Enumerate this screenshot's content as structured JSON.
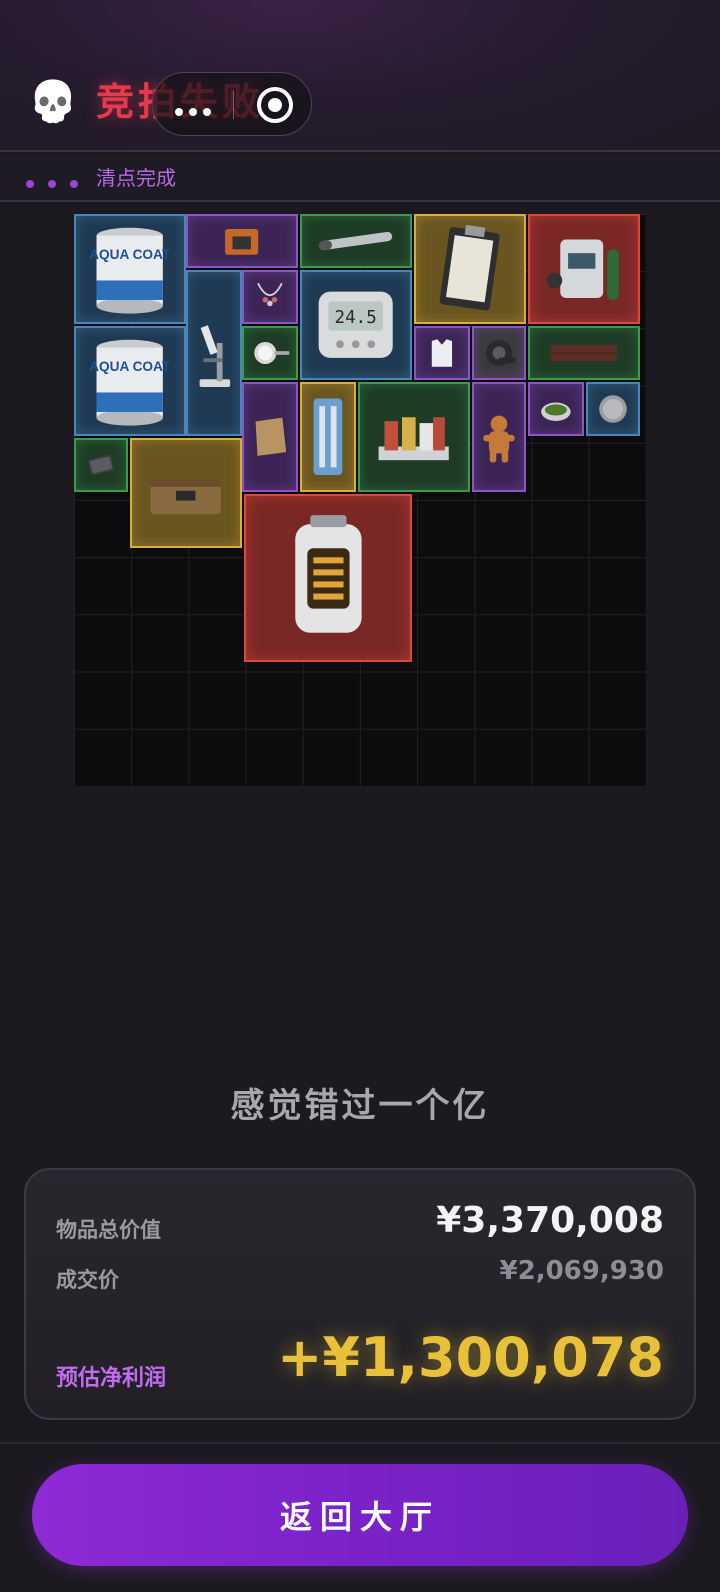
{
  "header": {
    "skull_icon": "skull-icon",
    "title": "竞拍失败",
    "capsule": {
      "more_icon": "more-dots-icon",
      "close_icon": "target-circle-icon"
    }
  },
  "status": {
    "text": "清点完成",
    "dot_color": "#9a45d8"
  },
  "grid": {
    "columns": 10,
    "rows": 10,
    "rarity_colors": {
      "blue": "#4a86b8",
      "purple": "#8b55c2",
      "green": "#3c9a4e",
      "gold": "#d6b03a",
      "red": "#e0463d"
    },
    "items": [
      {
        "name": "paint-can",
        "rarity": "blue",
        "text": "AQUA COAT"
      },
      {
        "name": "paint-can",
        "rarity": "blue",
        "text": "AQUA COAT"
      },
      {
        "name": "microscope",
        "rarity": "blue"
      },
      {
        "name": "radio-device",
        "rarity": "purple"
      },
      {
        "name": "metal-rod",
        "rarity": "green"
      },
      {
        "name": "clipboard",
        "rarity": "gold"
      },
      {
        "name": "breathing-apparatus",
        "rarity": "red"
      },
      {
        "name": "necklace",
        "rarity": "purple"
      },
      {
        "name": "digital-meter",
        "rarity": "blue",
        "text": "24.5"
      },
      {
        "name": "thermometer-dial",
        "rarity": "green"
      },
      {
        "name": "body-armor-vest",
        "rarity": "purple"
      },
      {
        "name": "duct-tape",
        "rarity": "purple"
      },
      {
        "name": "wooden-plank",
        "rarity": "green"
      },
      {
        "name": "old-paper",
        "rarity": "purple"
      },
      {
        "name": "tool-case",
        "rarity": "gold"
      },
      {
        "name": "spice-rack",
        "rarity": "green"
      },
      {
        "name": "gingerbread-man",
        "rarity": "purple"
      },
      {
        "name": "herb-bowl",
        "rarity": "purple"
      },
      {
        "name": "coin",
        "rarity": "blue"
      },
      {
        "name": "hard-drive",
        "rarity": "green"
      },
      {
        "name": "ammo-crate",
        "rarity": "gold"
      },
      {
        "name": "reactor-core",
        "rarity": "red"
      }
    ]
  },
  "result": {
    "slogan": "感觉错过一个亿",
    "total_label": "物品总价值",
    "total_value": "¥3,370,008",
    "deal_label": "成交价",
    "deal_value": "¥2,069,930",
    "profit_label": "预估净利润",
    "profit_value": "+¥1,300,078"
  },
  "footer": {
    "return_label": "返回大厅"
  }
}
